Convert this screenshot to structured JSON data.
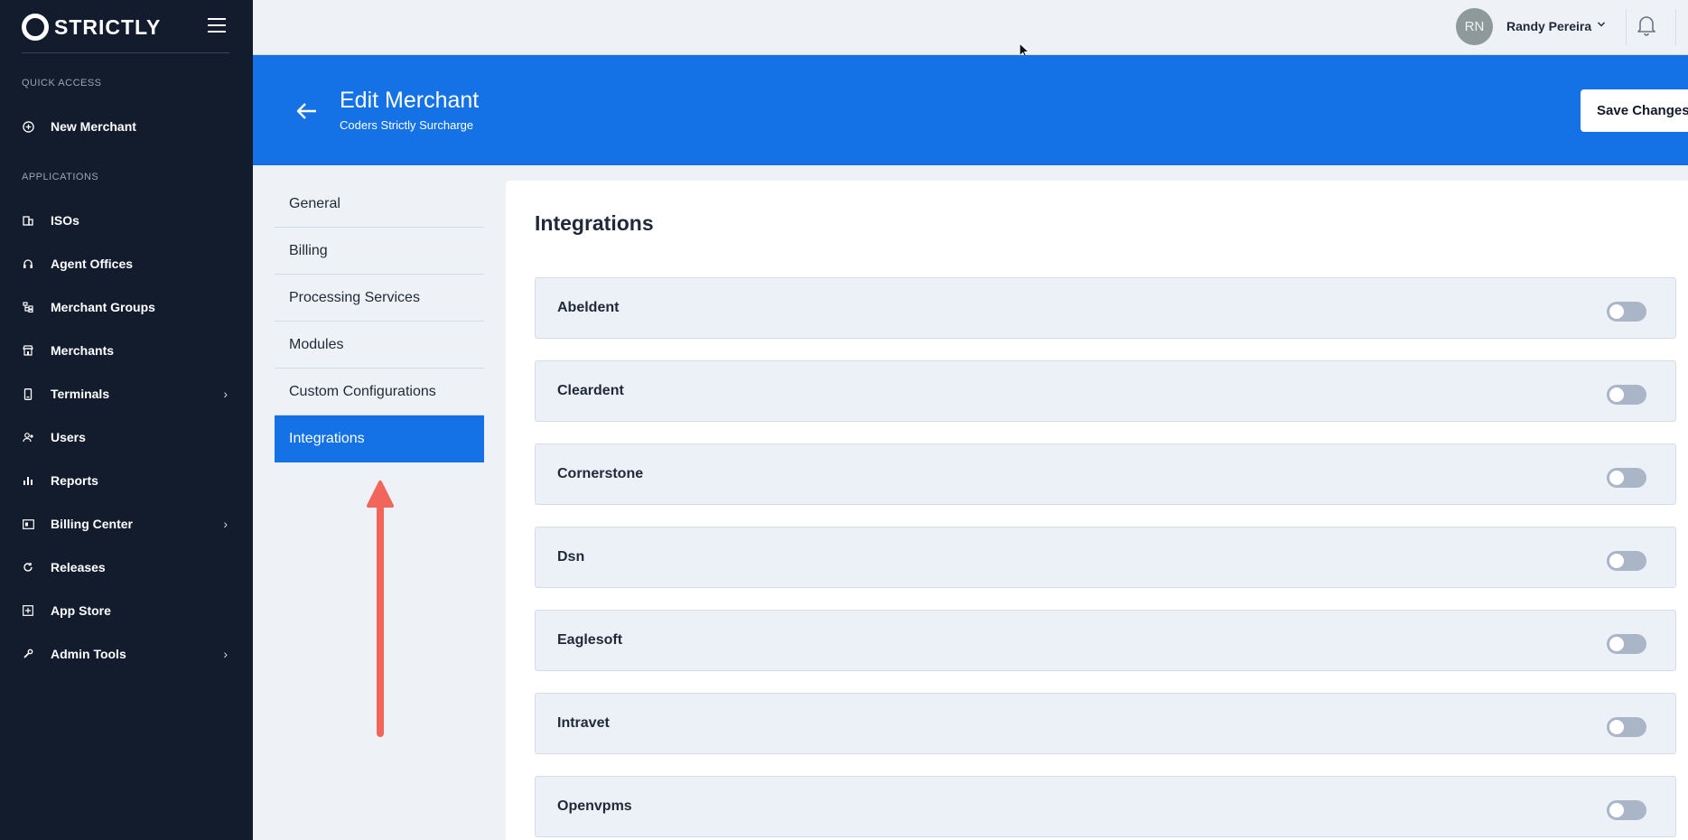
{
  "brand": {
    "name": "STRICTLY"
  },
  "sidebar": {
    "quick_access_label": "QUICK ACCESS",
    "quick_access_items": [
      {
        "label": "New Merchant",
        "icon": "plus-circle-icon"
      }
    ],
    "applications_label": "APPLICATIONS",
    "items": [
      {
        "label": "ISOs",
        "icon": "building-icon",
        "chevron": false
      },
      {
        "label": "Agent Offices",
        "icon": "headset-icon",
        "chevron": false
      },
      {
        "label": "Merchant Groups",
        "icon": "hierarchy-icon",
        "chevron": false
      },
      {
        "label": "Merchants",
        "icon": "storefront-icon",
        "chevron": false
      },
      {
        "label": "Terminals",
        "icon": "phone-device-icon",
        "chevron": true
      },
      {
        "label": "Users",
        "icon": "users-icon",
        "chevron": false
      },
      {
        "label": "Reports",
        "icon": "bar-chart-icon",
        "chevron": false
      },
      {
        "label": "Billing Center",
        "icon": "invoice-icon",
        "chevron": true
      },
      {
        "label": "Releases",
        "icon": "refresh-icon",
        "chevron": false
      },
      {
        "label": "App Store",
        "icon": "grid-box-icon",
        "chevron": false
      },
      {
        "label": "Admin Tools",
        "icon": "wrench-icon",
        "chevron": true
      }
    ]
  },
  "topbar": {
    "avatar_initials": "RN",
    "user_name": "Randy Pereira"
  },
  "header": {
    "title": "Edit Merchant",
    "subtitle": "Coders Strictly Surcharge",
    "save_label": "Save Changes"
  },
  "subnav": {
    "items": [
      {
        "label": "General",
        "active": false
      },
      {
        "label": "Billing",
        "active": false
      },
      {
        "label": "Processing Services",
        "active": false
      },
      {
        "label": "Modules",
        "active": false
      },
      {
        "label": "Custom Configurations",
        "active": false
      },
      {
        "label": "Integrations",
        "active": true
      }
    ]
  },
  "main": {
    "title": "Integrations",
    "integrations": [
      {
        "name": "Abeldent",
        "enabled": false
      },
      {
        "name": "Cleardent",
        "enabled": false
      },
      {
        "name": "Cornerstone",
        "enabled": false
      },
      {
        "name": "Dsn",
        "enabled": false
      },
      {
        "name": "Eaglesoft",
        "enabled": false
      },
      {
        "name": "Intravet",
        "enabled": false
      },
      {
        "name": "Openvpms",
        "enabled": false
      }
    ]
  },
  "colors": {
    "sidebar_bg": "#121c2c",
    "accent": "#1472e6",
    "annotation_arrow": "#f2655a",
    "toggle_off": "#aab5c8"
  }
}
